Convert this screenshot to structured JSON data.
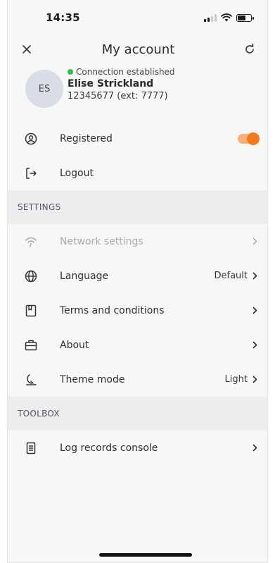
{
  "status_bar": {
    "time": "14:35"
  },
  "header": {
    "title": "My account",
    "close_icon": "close-icon",
    "refresh_icon": "refresh-icon"
  },
  "profile": {
    "initials": "ES",
    "connection_status": "Connection established",
    "connection_color": "#3db84a",
    "name": "Elise Strickland",
    "number": "12345677 (ext: 7777)"
  },
  "account_rows": [
    {
      "label": "Registered",
      "icon": "user-circle-icon",
      "toggle_on": true
    },
    {
      "label": "Logout",
      "icon": "logout-icon"
    }
  ],
  "settings": {
    "header": "SETTINGS",
    "items": [
      {
        "label": "Network settings",
        "icon": "network-icon",
        "disabled": true,
        "value": ""
      },
      {
        "label": "Language",
        "icon": "globe-icon",
        "value": "Default"
      },
      {
        "label": "Terms and conditions",
        "icon": "document-icon",
        "value": ""
      },
      {
        "label": "About",
        "icon": "briefcase-icon",
        "value": ""
      },
      {
        "label": "Theme mode",
        "icon": "theme-moon-icon",
        "value": "Light"
      }
    ]
  },
  "toolbox": {
    "header": "TOOLBOX",
    "items": [
      {
        "label": "Log records console",
        "icon": "log-records-icon",
        "value": ""
      }
    ]
  },
  "colors": {
    "accent": "#f07a1f",
    "accent_track": "#f7b079",
    "section_bg": "#ededf0"
  }
}
